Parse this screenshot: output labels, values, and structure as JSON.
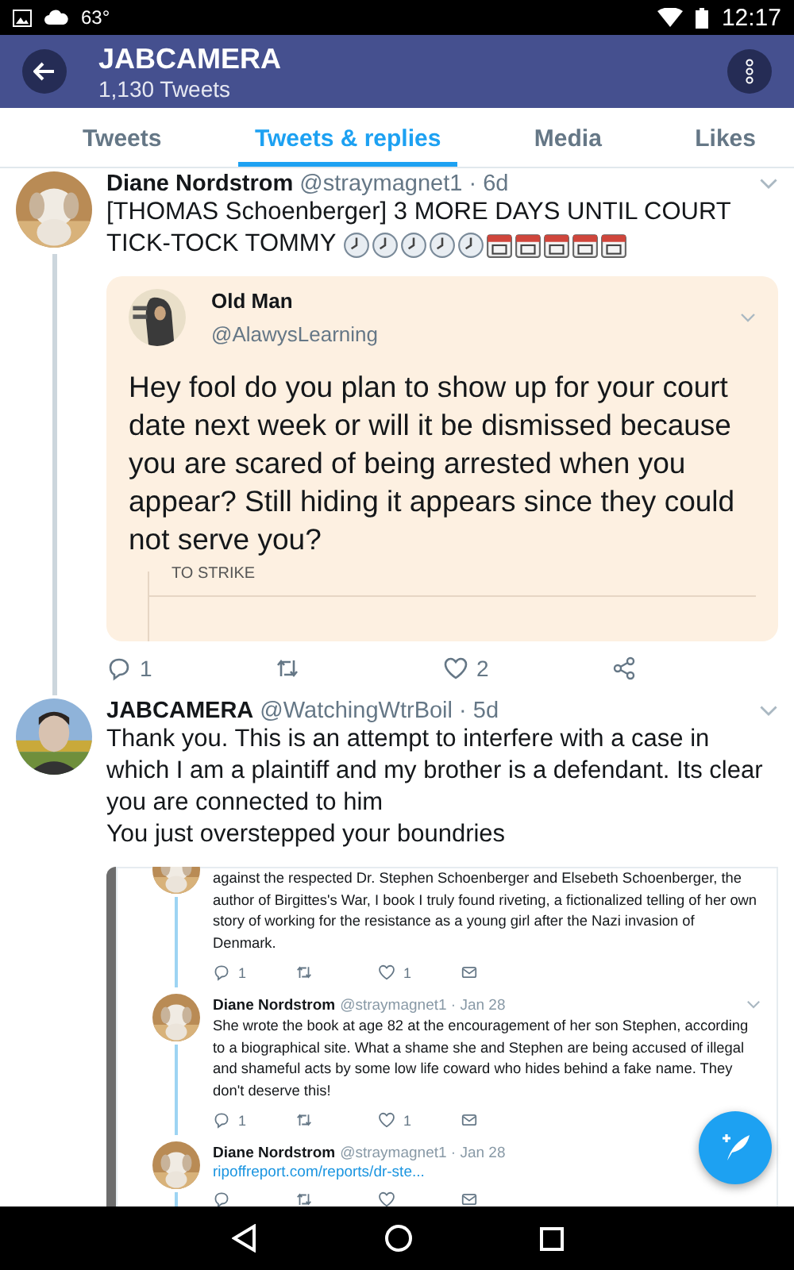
{
  "status_bar": {
    "temperature": "63°",
    "time": "12:17"
  },
  "header": {
    "title": "JABCAMERA",
    "subtitle": "1,130 Tweets"
  },
  "tabs": [
    {
      "label": "Tweets",
      "selected": false
    },
    {
      "label": "Tweets & replies",
      "selected": true
    },
    {
      "label": "Media",
      "selected": false
    },
    {
      "label": "Likes",
      "selected": false
    }
  ],
  "tweets": [
    {
      "author": "Diane Nordstrom",
      "handle": "@straymagnet1 · 6d",
      "text_lines": [
        "[THOMAS Schoenberger] 3 MORE DAYS UNTIL COURT",
        "TICK-TOCK TOMMY"
      ],
      "emoji": [
        {
          "kind": "clock"
        },
        {
          "kind": "clock"
        },
        {
          "kind": "clock"
        },
        {
          "kind": "clock"
        },
        {
          "kind": "clock"
        },
        {
          "kind": "calendar"
        },
        {
          "kind": "calendar"
        },
        {
          "kind": "calendar"
        },
        {
          "kind": "calendar"
        },
        {
          "kind": "calendar"
        }
      ],
      "quote": {
        "author": "Old Man",
        "handle": "@AlawysLearning",
        "text": "Hey fool do you plan to show up for your court date next week or will it be dismissed because you are scared of being arrested when you appear? Still hiding it appears since they could not serve you?",
        "image_text": "TO STRIKE"
      },
      "actions": {
        "replies": "1",
        "likes": "2"
      }
    },
    {
      "author": "JABCAMERA",
      "handle": "@WatchingWtrBoil · 5d",
      "text": "Thank you. This is an attempt to interfere with a case in which I am a plaintiff and my brother is a defendant. Its clear you are connected to him\nYou just overstepped your boundries",
      "screenshot": {
        "posts": [
          {
            "text": "against the respected Dr. Stephen Schoenberger and Elsebeth Schoenberger, the author of Birgittes's War, I book I truly found riveting, a fictionalized telling of her own story of working for the resistance as a young girl after the Nazi invasion of Denmark.",
            "replies": "1",
            "likes": "1"
          },
          {
            "author": "Diane Nordstrom",
            "handle": "@straymagnet1 · Jan 28",
            "text": "She wrote the book at age 82 at the encouragement of her son Stephen, according to a biographical site. What a shame she and Stephen are being accused of illegal and shameful acts by some low life coward who hides behind a fake name. They don't deserve this!",
            "replies": "1",
            "likes": "1"
          },
          {
            "author": "Diane Nordstrom",
            "handle": "@straymagnet1 · Jan 28",
            "link": "ripoffreport.com/reports/dr-ste..."
          }
        ]
      }
    }
  ]
}
